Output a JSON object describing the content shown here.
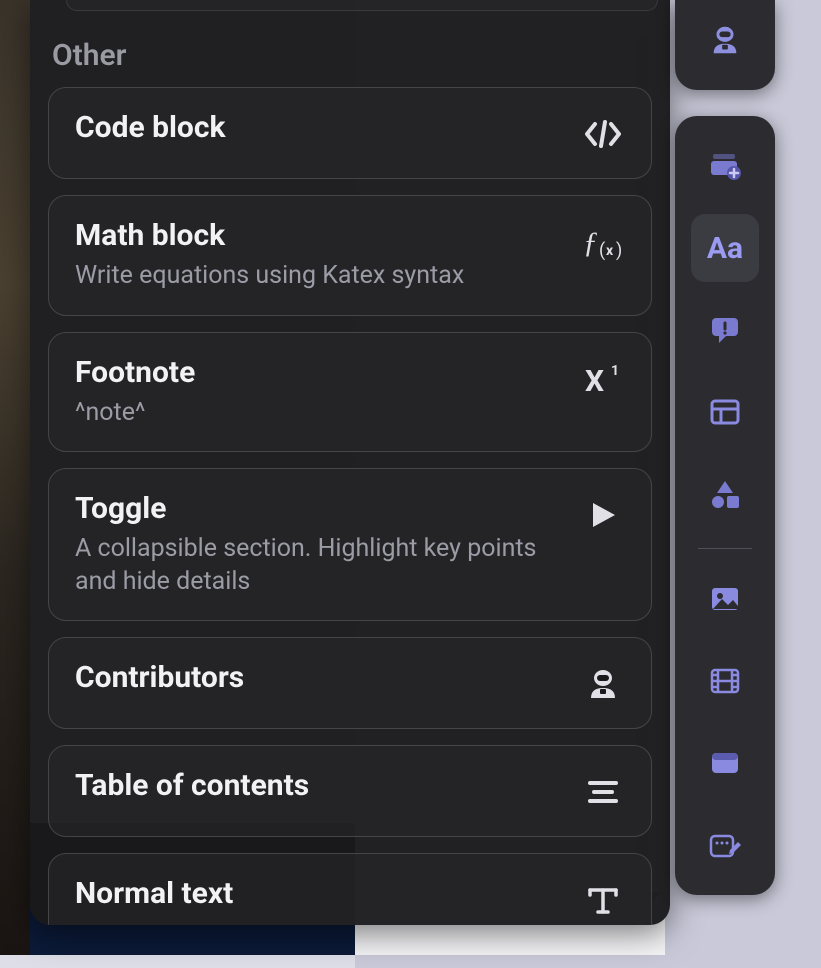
{
  "picker": {
    "section_label": "Other",
    "items": [
      {
        "title": "Code block",
        "desc": "",
        "icon": "code"
      },
      {
        "title": "Math block",
        "desc": "Write equations using Katex syntax",
        "icon": "fx"
      },
      {
        "title": "Footnote",
        "desc": "^note^",
        "icon": "x1"
      },
      {
        "title": "Toggle",
        "desc": "A collapsible section. Highlight key points and hide details",
        "icon": "play"
      },
      {
        "title": "Contributors",
        "desc": "",
        "icon": "astronaut"
      },
      {
        "title": "Table of contents",
        "desc": "",
        "icon": "toc"
      },
      {
        "title": "Normal text",
        "desc": "",
        "icon": "text"
      }
    ]
  },
  "sidebar": {
    "top_button": {
      "icon": "astronaut"
    },
    "buttons": [
      {
        "icon": "stack-add",
        "active": false
      },
      {
        "icon": "aa",
        "active": true
      },
      {
        "icon": "comment-alert",
        "active": false
      },
      {
        "icon": "layout",
        "active": false
      },
      {
        "icon": "shapes",
        "active": false
      }
    ],
    "buttons_lower": [
      {
        "icon": "image",
        "active": false
      },
      {
        "icon": "film",
        "active": false
      },
      {
        "icon": "card",
        "active": false
      },
      {
        "icon": "edit-note",
        "active": false
      }
    ]
  },
  "icons": {
    "aa_label": "Aa"
  }
}
